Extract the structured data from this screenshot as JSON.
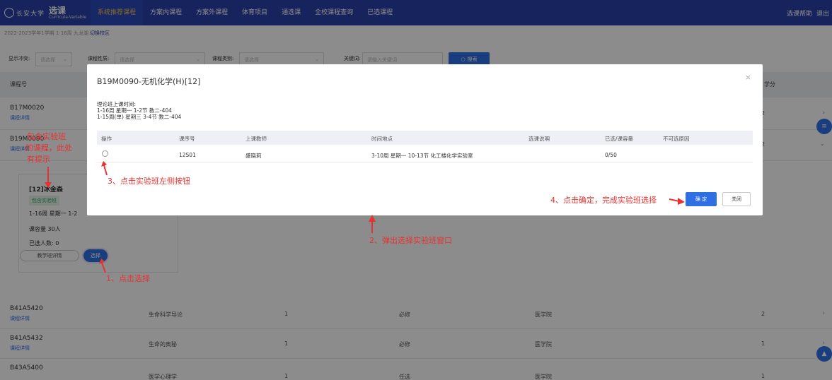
{
  "header": {
    "school": "长安大学",
    "app_title": "选课",
    "app_subtitle": "Curricula-Variable",
    "nav": [
      "系统推荐课程",
      "方案内课程",
      "方案外课程",
      "体育项目",
      "通选课",
      "全校课程查询",
      "已选课程"
    ],
    "help": "选课帮助",
    "logout": "退出"
  },
  "term": {
    "text": "2022-2023学年1学期  1-16周  九龙湖",
    "switch": "切换校区"
  },
  "filters": {
    "conflict_label": "显示冲突:",
    "conflict_placeholder": "请选择",
    "type_label": "课程性质:",
    "type_placeholder": "请选择",
    "category_label": "课程类别:",
    "category_placeholder": "请选择",
    "keyword_label": "关键词:",
    "keyword_placeholder": "请输入关键词",
    "search_label": "搜索"
  },
  "table": {
    "headers": {
      "code": "课程号",
      "credit": "学分"
    },
    "detail_label": "课程详情",
    "rows_top": [
      {
        "code": "B17M0020",
        "credit": "2"
      },
      {
        "code": "B19M0090",
        "credit": "2"
      }
    ],
    "rows_bottom": [
      {
        "code": "B41A5420",
        "name": "生命科学导论",
        "hours": "1",
        "nature": "必修",
        "college": "医学院",
        "credit": "2"
      },
      {
        "code": "B41A5432",
        "name": "生命的奥秘",
        "hours": "1",
        "nature": "必修",
        "college": "医学院",
        "credit": "1"
      },
      {
        "code": "B43A5400",
        "name": "医学心理学",
        "hours": "1",
        "nature": "任选",
        "college": "医学院",
        "credit": "1"
      }
    ]
  },
  "card": {
    "title": "[12]冰金森",
    "tag": "包含实验班",
    "time": "1-16周 星期一 1-2",
    "capacity": "课容量  30人",
    "selected": "已选人数:  0",
    "detail_btn": "教学班详情",
    "select_btn": "选择"
  },
  "modal": {
    "title": "B19M0090-无机化学(H)[12]",
    "info_title": "理论班上课时间:",
    "info_lines": [
      "1-16周 星期一 1-2节 教二-404",
      "1-15周(单) 星期三 3-4节 教二-404"
    ],
    "columns": [
      "操作",
      "课序号",
      "上课教师",
      "时间地点",
      "选课说明",
      "已选/课容量",
      "不可选原因"
    ],
    "row": {
      "section": "12S01",
      "teacher": "盛晓莉",
      "time_place": "3-10周 星期一 10-13节 化工楼化学实验室",
      "note": "",
      "capacity": "0/50",
      "reason": ""
    },
    "ok_label": "确 定",
    "close_label": "关闭"
  },
  "annotations": {
    "a_left": [
      "包含实验班",
      "的课程，此处",
      "有提示"
    ],
    "a1": "1、点击选择",
    "a2": "2、弹出选择实验班窗口",
    "a3": "3、点击实验班左侧按钮",
    "a4": "4、点击确定，完成实验班选择"
  },
  "colors": {
    "nav_bg": "#2a41a8",
    "primary": "#2f6fe4",
    "annotation": "#e8322f",
    "active_nav": "#f2c94c"
  }
}
